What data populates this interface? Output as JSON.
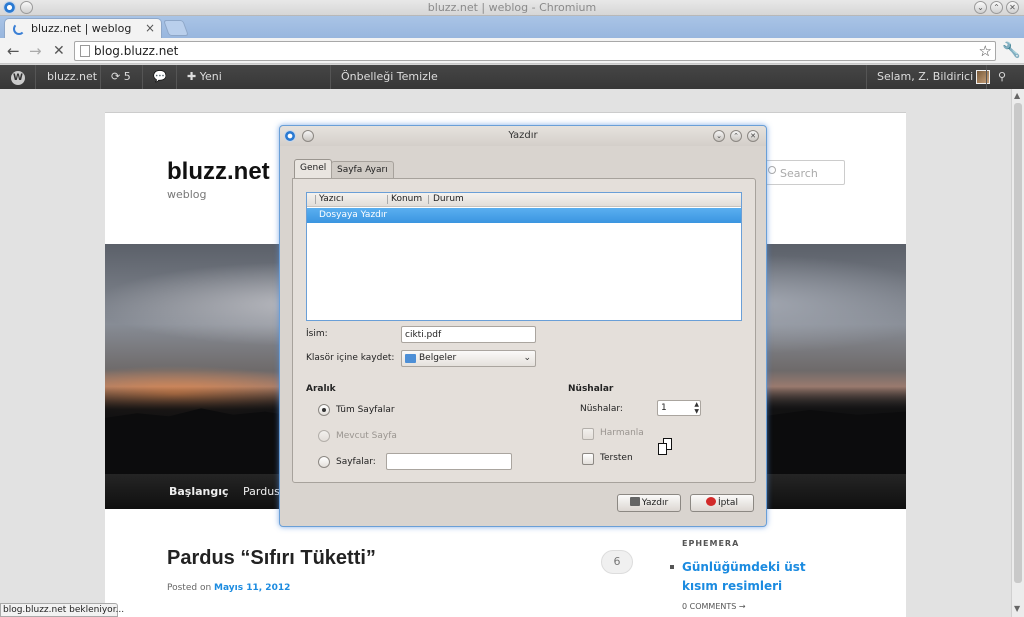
{
  "window": {
    "title": "bluzz.net | weblog - Chromium"
  },
  "tabs": [
    {
      "label": "bluzz.net | weblog"
    }
  ],
  "toolbar": {
    "url": "blog.bluzz.net"
  },
  "adminbar": {
    "site": "bluzz.net",
    "updates": "5",
    "new_label": "Yeni",
    "cache": "Önbelleği Temizle",
    "greeting": "Selam, Z. Bildirici"
  },
  "site": {
    "title": "bluzz.net",
    "description": "weblog",
    "search_placeholder": "Search",
    "menu": [
      "Başlangıç",
      "Pardus"
    ],
    "post_title": "Pardus “Sıfırı Tüketti”",
    "posted_on": "Posted on",
    "post_date": "Mayıs 11, 2012",
    "comment_count": "6",
    "sidebar_heading": "EPHEMERA",
    "sidebar_link": "Günlüğümdeki üst kısım resimleri",
    "sidebar_comments": "0 COMMENTS →"
  },
  "status": "blog.bluzz.net bekleniyor...",
  "dialog": {
    "title": "Yazdır",
    "tabs": [
      "Genel",
      "Sayfa Ayarı"
    ],
    "columns": [
      "Yazıcı",
      "Konum",
      "Durum"
    ],
    "printers": [
      "Dosyaya Yazdır"
    ],
    "name_label": "İsim:",
    "name_value": "cikti.pdf",
    "folder_label": "Klasör içine kaydet:",
    "folder_value": "Belgeler",
    "range_heading": "Aralık",
    "range_all": "Tüm Sayfalar",
    "range_current": "Mevcut Sayfa",
    "range_pages": "Sayfalar:",
    "copies_heading": "Nüshalar",
    "copies_label": "Nüshalar:",
    "copies_value": "1",
    "collate": "Harmanla",
    "reverse": "Tersten",
    "print_button": "Yazdır",
    "cancel_button": "İptal"
  },
  "colors": {
    "accent_blue": "#3b95e0",
    "link_blue": "#1b8be0",
    "adminbar": "#3a3a3a",
    "cancel_red": "#d22a2a"
  }
}
